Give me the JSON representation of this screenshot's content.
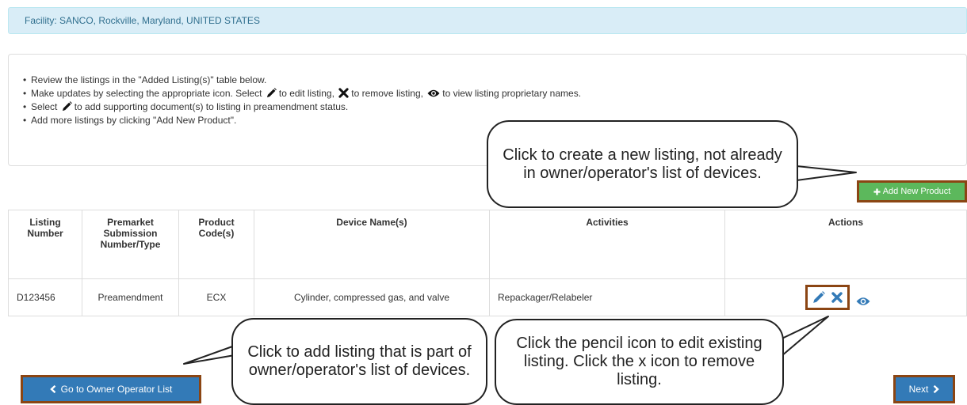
{
  "facility": {
    "text": "Facility: SANCO, Rockville, Maryland, UNITED STATES"
  },
  "instructions": {
    "line1": "Review the listings in the \"Added Listing(s)\" table below.",
    "line2_a": "Make updates by selecting the appropriate icon. Select",
    "line2_b": "to edit listing,",
    "line2_c": "to remove listing,",
    "line2_d": "to view listing proprietary names.",
    "line3_a": "Select",
    "line3_b": "to add supporting document(s) to listing in preamendment status.",
    "line4": "Add more listings by clicking \"Add New Product\"."
  },
  "add_product": {
    "label": "Add New Product",
    "icon": "plus-icon"
  },
  "table": {
    "headers": [
      "Listing Number",
      "Premarket Submission Number/Type",
      "Product Code(s)",
      "Device Name(s)",
      "Activities",
      "Actions"
    ],
    "rows": [
      {
        "listing_number": "D123456",
        "premarket": "Preamendment",
        "product_code": "ECX",
        "device_name": "Cylinder, compressed gas, and valve",
        "activities": "Repackager/Relabeler"
      }
    ]
  },
  "nav": {
    "back_label": "Go to Owner Operator List",
    "next_label": "Next"
  },
  "callouts": {
    "add_new": "Click to create a new listing, not already in owner/operator's list of devices.",
    "owner_list": "Click to add listing that is part of owner/operator's list of devices.",
    "pencil": "Click the pencil icon to edit existing listing. Click the x icon to remove listing."
  },
  "colors": {
    "info_bg": "#d9edf7",
    "success": "#5cb85c",
    "primary": "#337ab7",
    "highlight_border": "#8b4513"
  }
}
